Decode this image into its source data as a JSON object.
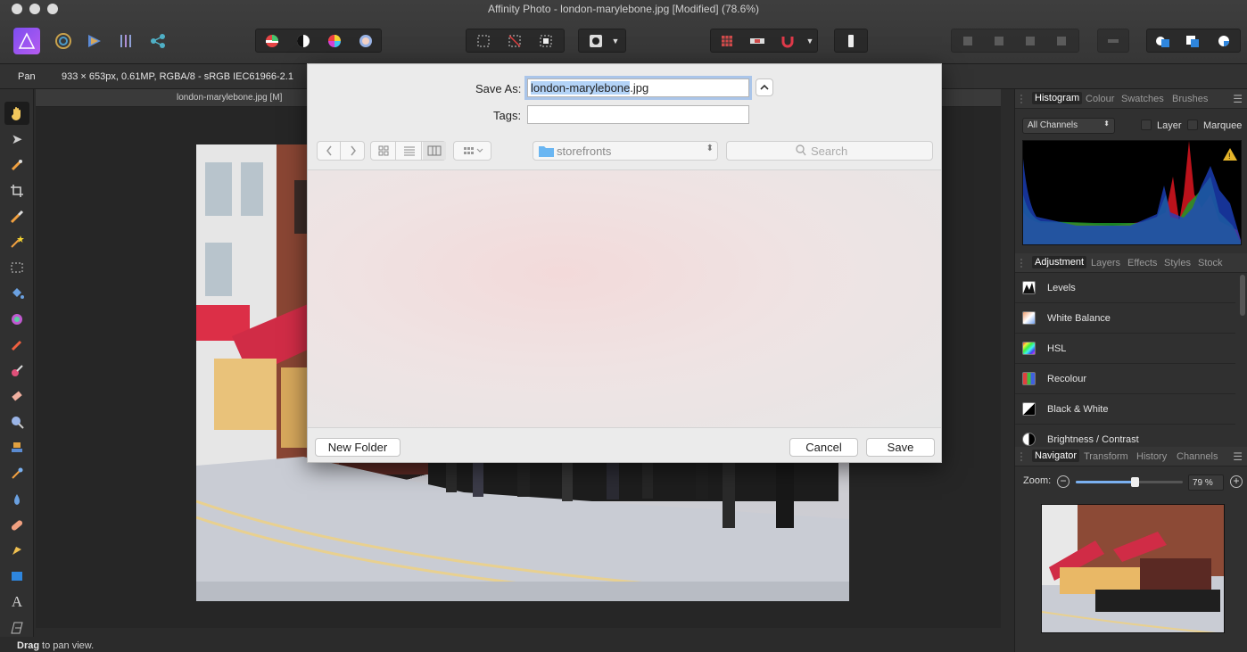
{
  "window": {
    "title": "Affinity Photo - london-marylebone.jpg [Modified] (78.6%)"
  },
  "context": {
    "tool_name": "Pan",
    "doc_info": "933 × 653px, 0.61MP, RGBA/8 - sRGB IEC61966-2.1"
  },
  "document": {
    "tab_label": "london-marylebone.jpg [M]"
  },
  "status": {
    "bold": "Drag",
    "rest": " to pan view."
  },
  "histogram_panel": {
    "tabs": [
      "Histogram",
      "Colour",
      "Swatches",
      "Brushes"
    ],
    "channel": "All Channels",
    "layer_label": "Layer",
    "marquee_label": "Marquee"
  },
  "adjustment_panel": {
    "tabs": [
      "Adjustment",
      "Layers",
      "Effects",
      "Styles",
      "Stock"
    ],
    "items": [
      "Levels",
      "White Balance",
      "HSL",
      "Recolour",
      "Black & White",
      "Brightness / Contrast"
    ]
  },
  "navigator_panel": {
    "tabs": [
      "Navigator",
      "Transform",
      "History",
      "Channels"
    ],
    "zoom_label": "Zoom:",
    "zoom_value": "79 %",
    "zoom_fraction": 0.55
  },
  "save_dialog": {
    "save_as_label": "Save As:",
    "filename_selected": "london-marylebone",
    "filename_ext": ".jpg",
    "tags_label": "Tags:",
    "location": "storefronts",
    "search_placeholder": "Search",
    "new_folder": "New Folder",
    "cancel": "Cancel",
    "save": "Save"
  },
  "colors": {
    "accent": "#1680f5",
    "selection": "#b3d3f7"
  }
}
